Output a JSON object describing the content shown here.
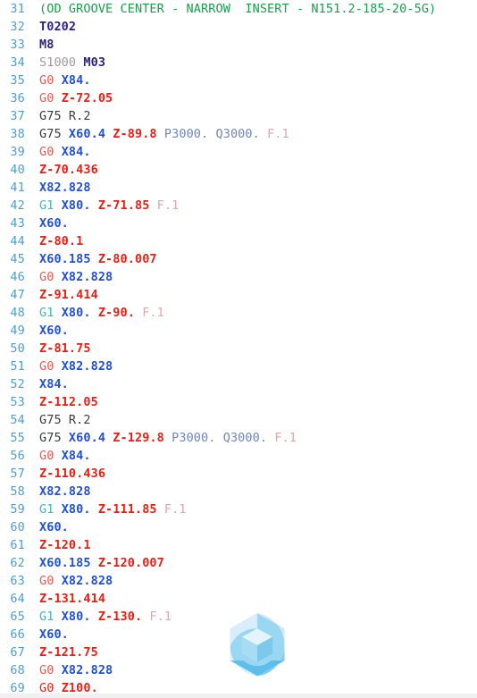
{
  "editor": {
    "title": "G-Code Program Editor",
    "language": "gcode",
    "first_visible_line": 31,
    "last_visible_line": 69,
    "background_color": "#ffffff",
    "gutter_color": "#4a9fd4",
    "watermark": {
      "name": "hexagon-cube-logo",
      "colors": [
        "#bfe4f7",
        "#8ed2f0",
        "#5bc0ea",
        "#d9eefb"
      ]
    },
    "token_colors": {
      "comment": "#16a04a",
      "tool": "#2b1f8f",
      "mcode": "#28227c",
      "scode": "#a09b9b",
      "g0": "#f2564e",
      "g0_bright": "#ee1c10",
      "g1": "#3fb9b9",
      "g_plain": "#3b3b3b",
      "x_axis": "#1f4fd8",
      "z_axis": "#ee1c10",
      "pq_param": "#6f86b8",
      "feed": "#d9a7ae"
    }
  },
  "lines": [
    {
      "n": "31",
      "tokens": [
        {
          "t": "(OD GROOVE CENTER - NARROW  INSERT - N151.2-185-20-5G)",
          "c": "t-comment"
        }
      ]
    },
    {
      "n": "32",
      "tokens": [
        {
          "t": "T0202",
          "c": "t-tool"
        }
      ]
    },
    {
      "n": "33",
      "tokens": [
        {
          "t": "M8",
          "c": "t-mcode"
        }
      ]
    },
    {
      "n": "34",
      "tokens": [
        {
          "t": "S1000 ",
          "c": "t-scode"
        },
        {
          "t": "M03",
          "c": "t-mcode"
        }
      ]
    },
    {
      "n": "35",
      "tokens": [
        {
          "t": "G0 ",
          "c": "t-g0"
        },
        {
          "t": "X84.",
          "c": "t-x"
        }
      ]
    },
    {
      "n": "36",
      "tokens": [
        {
          "t": "G0 ",
          "c": "t-g0"
        },
        {
          "t": "Z-72.05",
          "c": "t-z"
        }
      ]
    },
    {
      "n": "37",
      "tokens": [
        {
          "t": "G75 R.2",
          "c": "t-gplain"
        }
      ]
    },
    {
      "n": "38",
      "tokens": [
        {
          "t": "G75 ",
          "c": "t-gplain"
        },
        {
          "t": "X60.4 ",
          "c": "t-x"
        },
        {
          "t": "Z-89.8 ",
          "c": "t-z"
        },
        {
          "t": "P3000. Q3000. ",
          "c": "t-pq"
        },
        {
          "t": "F.1",
          "c": "t-f"
        }
      ]
    },
    {
      "n": "39",
      "tokens": [
        {
          "t": "G0 ",
          "c": "t-g0"
        },
        {
          "t": "X84.",
          "c": "t-x"
        }
      ]
    },
    {
      "n": "40",
      "tokens": [
        {
          "t": "Z-70.436",
          "c": "t-z"
        }
      ]
    },
    {
      "n": "41",
      "tokens": [
        {
          "t": "X82.828",
          "c": "t-x"
        }
      ]
    },
    {
      "n": "42",
      "tokens": [
        {
          "t": "G1 ",
          "c": "t-g1"
        },
        {
          "t": "X80. ",
          "c": "t-x"
        },
        {
          "t": "Z-71.85 ",
          "c": "t-z"
        },
        {
          "t": "F.1",
          "c": "t-f"
        }
      ]
    },
    {
      "n": "43",
      "tokens": [
        {
          "t": "X60.",
          "c": "t-x"
        }
      ]
    },
    {
      "n": "44",
      "tokens": [
        {
          "t": "Z-80.1",
          "c": "t-z"
        }
      ]
    },
    {
      "n": "45",
      "tokens": [
        {
          "t": "X60.185 ",
          "c": "t-x"
        },
        {
          "t": "Z-80.007",
          "c": "t-z"
        }
      ]
    },
    {
      "n": "46",
      "tokens": [
        {
          "t": "G0 ",
          "c": "t-g0"
        },
        {
          "t": "X82.828",
          "c": "t-x"
        }
      ]
    },
    {
      "n": "47",
      "tokens": [
        {
          "t": "Z-91.414",
          "c": "t-z"
        }
      ]
    },
    {
      "n": "48",
      "tokens": [
        {
          "t": "G1 ",
          "c": "t-g1"
        },
        {
          "t": "X80. ",
          "c": "t-x"
        },
        {
          "t": "Z-90. ",
          "c": "t-z"
        },
        {
          "t": "F.1",
          "c": "t-f"
        }
      ]
    },
    {
      "n": "49",
      "tokens": [
        {
          "t": "X60.",
          "c": "t-x"
        }
      ]
    },
    {
      "n": "50",
      "tokens": [
        {
          "t": "Z-81.75",
          "c": "t-z"
        }
      ]
    },
    {
      "n": "51",
      "tokens": [
        {
          "t": "G0 ",
          "c": "t-g0"
        },
        {
          "t": "X82.828",
          "c": "t-x"
        }
      ]
    },
    {
      "n": "52",
      "tokens": [
        {
          "t": "X84.",
          "c": "t-x"
        }
      ]
    },
    {
      "n": "53",
      "tokens": [
        {
          "t": "Z-112.05",
          "c": "t-z"
        }
      ]
    },
    {
      "n": "54",
      "tokens": [
        {
          "t": "G75 R.2",
          "c": "t-gplain"
        }
      ]
    },
    {
      "n": "55",
      "tokens": [
        {
          "t": "G75 ",
          "c": "t-gplain"
        },
        {
          "t": "X60.4 ",
          "c": "t-x"
        },
        {
          "t": "Z-129.8 ",
          "c": "t-z"
        },
        {
          "t": "P3000. Q3000. ",
          "c": "t-pq"
        },
        {
          "t": "F.1",
          "c": "t-f"
        }
      ]
    },
    {
      "n": "56",
      "tokens": [
        {
          "t": "G0 ",
          "c": "t-g0"
        },
        {
          "t": "X84.",
          "c": "t-x"
        }
      ]
    },
    {
      "n": "57",
      "tokens": [
        {
          "t": "Z-110.436",
          "c": "t-z"
        }
      ]
    },
    {
      "n": "58",
      "tokens": [
        {
          "t": "X82.828",
          "c": "t-x"
        }
      ]
    },
    {
      "n": "59",
      "tokens": [
        {
          "t": "G1 ",
          "c": "t-g1"
        },
        {
          "t": "X80. ",
          "c": "t-x"
        },
        {
          "t": "Z-111.85 ",
          "c": "t-z"
        },
        {
          "t": "F.1",
          "c": "t-f"
        }
      ]
    },
    {
      "n": "60",
      "tokens": [
        {
          "t": "X60.",
          "c": "t-x"
        }
      ]
    },
    {
      "n": "61",
      "tokens": [
        {
          "t": "Z-120.1",
          "c": "t-z"
        }
      ]
    },
    {
      "n": "62",
      "tokens": [
        {
          "t": "X60.185 ",
          "c": "t-x"
        },
        {
          "t": "Z-120.007",
          "c": "t-z"
        }
      ]
    },
    {
      "n": "63",
      "tokens": [
        {
          "t": "G0 ",
          "c": "t-g0"
        },
        {
          "t": "X82.828",
          "c": "t-x"
        }
      ]
    },
    {
      "n": "64",
      "tokens": [
        {
          "t": "Z-131.414",
          "c": "t-z"
        }
      ]
    },
    {
      "n": "65",
      "tokens": [
        {
          "t": "G1 ",
          "c": "t-g1"
        },
        {
          "t": "X80. ",
          "c": "t-x"
        },
        {
          "t": "Z-130. ",
          "c": "t-z"
        },
        {
          "t": "F.1",
          "c": "t-f"
        }
      ]
    },
    {
      "n": "66",
      "tokens": [
        {
          "t": "X60.",
          "c": "t-x"
        }
      ]
    },
    {
      "n": "67",
      "tokens": [
        {
          "t": "Z-121.75",
          "c": "t-z"
        }
      ]
    },
    {
      "n": "68",
      "tokens": [
        {
          "t": "G0 ",
          "c": "t-g0"
        },
        {
          "t": "X82.828",
          "c": "t-x"
        }
      ]
    },
    {
      "n": "69",
      "tokens": [
        {
          "t": "G0 ",
          "c": "t-g0b"
        },
        {
          "t": "Z100.",
          "c": "t-z"
        }
      ]
    }
  ]
}
